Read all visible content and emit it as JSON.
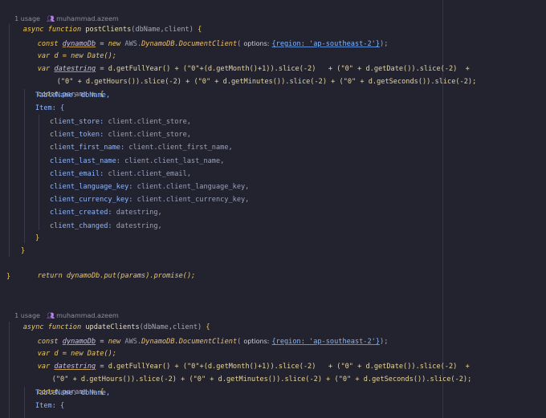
{
  "blocks": [
    {
      "usage": "1 usage",
      "author": "muhammad.azeem",
      "signature": {
        "async": "async",
        "function": "function",
        "name": "postClients",
        "params": "(dbName,client)",
        "brace": "{"
      },
      "new_doc": "new",
      "aws": "AWS.",
      "ddb_class": "DynamoDB.DocumentClient",
      "opts_hint": "options:",
      "region": "{region: 'ap-southeast-2'}",
      "date_line": "var d = new Date();",
      "datestring_line_a": "d.getFullYear() + (\"0\"+(d.getMonth()+1)).slice(-2)   + (\"0\" + d.getDate()).slice(-2)  +",
      "datestring_line_b": "(\"0\" + d.getHours()).slice(-2) + (\"0\" + d.getMinutes()).slice(-2) + (\"0\" + d.getSeconds()).slice(-2);",
      "params_open": "{",
      "table_name": "TableName: dbName,",
      "item_open": "Item: {",
      "fields": [
        "client_store: client.client_store,",
        "client_token: client.client_store,",
        "client_first_name: client.client_first_name,",
        "client_last_name: client.client_last_name,",
        "client_email: client.client_email,",
        "client_language_key: client.client_language_key,",
        "client_currency_key: client.client_currency_key,",
        "client_created: datestring,",
        "client_changed: datestring,"
      ],
      "item_close": "}",
      "params_close": "}",
      "return_line": "return dynamoDb.put(params).promise();",
      "fn_close": "}"
    },
    {
      "usage": "1 usage",
      "author": "muhammad.azeem",
      "signature": {
        "async": "async",
        "function": "function",
        "name": "updateClients",
        "params": "(dbName,client)",
        "brace": "{"
      },
      "new_doc": "new",
      "aws": "AWS.",
      "ddb_class": "DynamoDB.DocumentClient",
      "opts_hint": "options:",
      "region": "{region: 'ap-southeast-2'}",
      "date_line": "var d = new Date();",
      "datestring_line_a": "d.getFullYear() + (\"0\"+(d.getMonth()+1)).slice(-2)   + (\"0\" + d.getDate()).slice(-2)  +",
      "datestring_line_b": "(\"0\" + d.getHours()).slice(-2) + (\"0\" + d.getMinutes()).slice(-2) + (\"0\" + d.getSeconds()).slice(-2);",
      "params_open": "{",
      "table_name": "TableName: dbName,",
      "item_open": "Item: {"
    }
  ],
  "tokens": {
    "const": "const",
    "var": "var",
    "dynamoDb": "dynamoDb",
    "datestring": "datestring",
    "params": "params",
    "eq": " = ",
    "paren_close": ");"
  },
  "colors": {
    "background": "#23232f",
    "keyword": "#f1c75b",
    "string": "#a8de8a",
    "property": "#8fb6ff",
    "meta": "#8c8ca3"
  },
  "icons": {
    "author": "people-icon"
  }
}
